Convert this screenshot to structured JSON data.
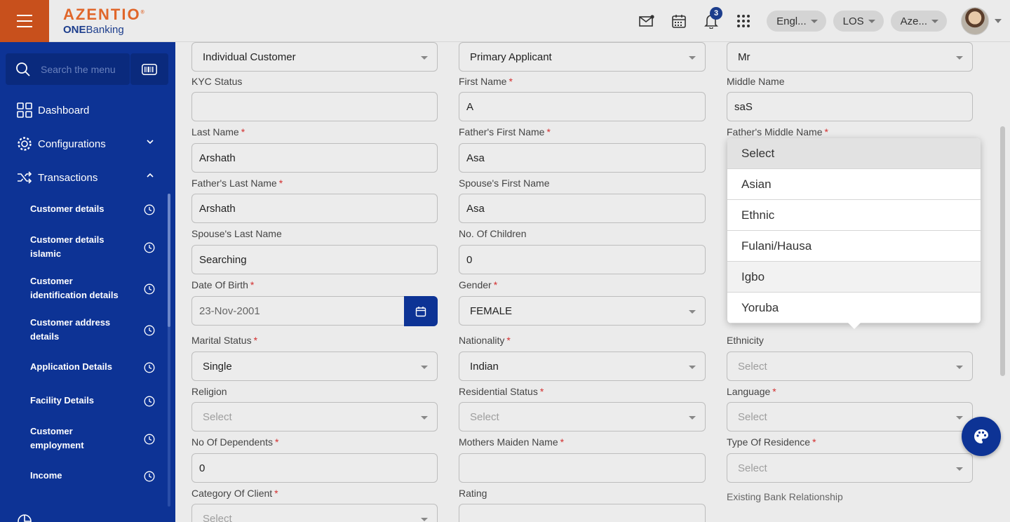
{
  "brand": {
    "name": "AZENTIO",
    "sub_bold": "ONE",
    "sub_rest": "Banking"
  },
  "header": {
    "notifications_count": "3",
    "language": "Engl...",
    "module": "LOS",
    "entity": "Aze..."
  },
  "sidebar": {
    "search_placeholder": "Search the menu",
    "items": [
      {
        "label": "Dashboard",
        "icon": "grid-icon"
      },
      {
        "label": "Configurations",
        "icon": "gear-icon"
      },
      {
        "label": "Transactions",
        "icon": "shuffle-icon"
      }
    ],
    "sub_items": [
      {
        "line1": "Customer details",
        "line2": ""
      },
      {
        "line1": "Customer details",
        "line2": "islamic"
      },
      {
        "line1": "Customer",
        "line2": "identification details"
      },
      {
        "line1": "Customer address",
        "line2": "details"
      },
      {
        "line1": "Application Details",
        "line2": ""
      },
      {
        "line1": "Facility Details",
        "line2": ""
      },
      {
        "line1": "Customer",
        "line2": "employment"
      },
      {
        "line1": "Income",
        "line2": ""
      }
    ]
  },
  "form": {
    "customer_type": "Individual Customer",
    "applicant_type": "Primary Applicant",
    "title": "Mr",
    "kyc_status": {
      "label": "KYC Status",
      "value": ""
    },
    "first_name": {
      "label": "First Name",
      "value": "A"
    },
    "middle_name": {
      "label": "Middle Name",
      "value": "saS"
    },
    "last_name": {
      "label": "Last Name",
      "value": "Arshath"
    },
    "fathers_first_name": {
      "label": "Father's First Name",
      "value": "Asa"
    },
    "fathers_middle_name": {
      "label": "Father's Middle Name"
    },
    "fathers_last_name": {
      "label": "Father's Last Name",
      "value": "Arshath"
    },
    "spouses_first_name": {
      "label": "Spouse's First Name",
      "value": "Asa"
    },
    "spouses_last_name": {
      "label": "Spouse's Last Name",
      "value": "Searching"
    },
    "no_of_children": {
      "label": "No. Of Children",
      "value": "0"
    },
    "date_of_birth": {
      "label": "Date Of Birth",
      "value": "23-Nov-2001"
    },
    "gender": {
      "label": "Gender",
      "value": "FEMALE"
    },
    "marital_status": {
      "label": "Marital Status",
      "value": "Single"
    },
    "nationality": {
      "label": "Nationality",
      "value": "Indian"
    },
    "ethnicity": {
      "label": "Ethnicity",
      "value": "Select"
    },
    "religion": {
      "label": "Religion",
      "value": "Select"
    },
    "residential_status": {
      "label": "Residential Status",
      "value": "Select"
    },
    "language": {
      "label": "Language",
      "value": "Select"
    },
    "no_of_dependents": {
      "label": "No Of Dependents",
      "value": "0"
    },
    "mothers_maiden_name": {
      "label": "Mothers Maiden Name",
      "value": ""
    },
    "type_of_residence": {
      "label": "Type Of Residence",
      "value": "Select"
    },
    "category_of_client": {
      "label": "Category Of Client",
      "value": "Select"
    },
    "rating": {
      "label": "Rating",
      "value": ""
    },
    "existing_bank_relationship": {
      "label": "Existing Bank Relationship"
    }
  },
  "dropdown": {
    "options": [
      "Select",
      "Asian",
      "Ethnic",
      "Fulani/Hausa",
      "Igbo",
      "Yoruba"
    ]
  },
  "colors": {
    "brand_orange": "#c8501c",
    "primary_blue": "#0d3395",
    "required_red": "#d32f2f"
  }
}
